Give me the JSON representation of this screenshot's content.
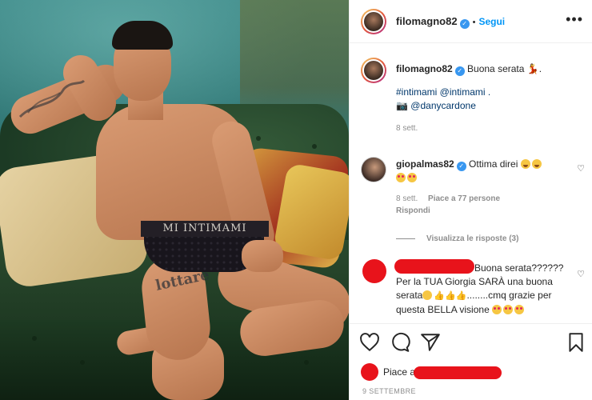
{
  "post": {
    "author": "filomagno82",
    "follow_label": "Segui",
    "dot": "•",
    "more": "•••",
    "caption_text": "Buona serata",
    "caption_emoji": "💃",
    "caption_tags": "#intimami @intimami .",
    "caption_credit_emoji": "📷",
    "caption_credit": "@danycardone",
    "caption_age": "8 sett.",
    "photo_text": {
      "waistband": "MI INTIMAMI",
      "tattoo": "lottare"
    }
  },
  "comments": [
    {
      "user": "giopalmas82",
      "text": "Ottima direi",
      "age": "8 sett.",
      "likes": "Piace a 77 persone",
      "reply": "Rispondi",
      "view_replies": "Visualizza le risposte (3)"
    },
    {
      "user": "",
      "text_line1": "Buona serata??????",
      "text_line2": "Per la TUA Giorgia SARÀ una buona",
      "text_line3_start": "serata",
      "text_line3_end": "........cmq grazie per",
      "text_line4": "questa BELLA visione"
    }
  ],
  "footer": {
    "likes_prefix": "Piace a",
    "date": "9 SETTEMBRE"
  },
  "icons": {
    "heart": "♡"
  },
  "colors": {
    "link_blue": "#0095f6",
    "redaction": "#e8131b"
  }
}
